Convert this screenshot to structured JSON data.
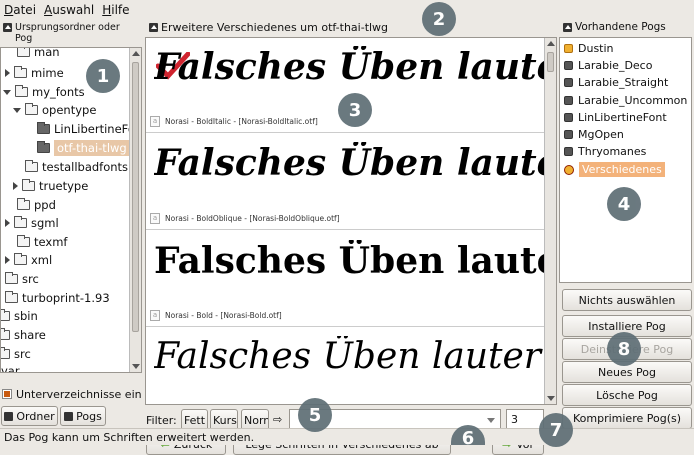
{
  "menu": [
    "Datei",
    "Auswahl",
    "Hilfe"
  ],
  "left_panel": {
    "title": "Ursprungsordner oder Pog",
    "tree": [
      {
        "label": "man"
      },
      {
        "label": "mime"
      },
      {
        "label": "my_fonts"
      },
      {
        "label": "opentype"
      },
      {
        "label": "LinLibertineFo"
      },
      {
        "label": "otf-thai-tlwg"
      },
      {
        "label": "testallbadfonts"
      },
      {
        "label": "truetype"
      },
      {
        "label": "ppd"
      },
      {
        "label": "sgml"
      },
      {
        "label": "texmf"
      },
      {
        "label": "xml"
      },
      {
        "label": "src"
      },
      {
        "label": "turboprint-1.93"
      },
      {
        "label": "sbin"
      },
      {
        "label": "share"
      },
      {
        "label": "src"
      },
      {
        "label": "var"
      }
    ],
    "recurse_checkbox": "Unterverzeichnisse ein",
    "recurse_checked": true,
    "tab_ordner": "Ordner",
    "tab_pogs": "Pogs"
  },
  "center_panel": {
    "title": "Erweitere Verschiedenes um otf-thai-tlwg",
    "sample_text": "Falsches Üben lauter X",
    "fonts": [
      {
        "caption": "Norasi - BoldItalic - [Norasi-BoldItalic.otf]"
      },
      {
        "caption": "Norasi - BoldOblique - [Norasi-BoldOblique.otf]"
      },
      {
        "caption": "Norasi - Bold - [Norasi-Bold.otf]"
      },
      {
        "caption": ""
      }
    ],
    "filter_label": "Filter:",
    "filter_buttons": [
      "Fett",
      "Kursiv",
      "Normal"
    ],
    "filter_value": "",
    "size_value": "3",
    "back_button": "Zurück",
    "install_into_button": "Lege Schriften in Verschiedenes ab",
    "forward_button": "Vor"
  },
  "right_panel": {
    "title": "Vorhandene Pogs",
    "pogs": [
      {
        "label": "Dustin",
        "icon": "orange"
      },
      {
        "label": "Larabie_Deco",
        "icon": "dark"
      },
      {
        "label": "Larabie_Straight",
        "icon": "dark"
      },
      {
        "label": "Larabie_Uncommon",
        "icon": "dark"
      },
      {
        "label": "LinLibertineFont",
        "icon": "dark"
      },
      {
        "label": "MgOpen",
        "icon": "dark"
      },
      {
        "label": "Thryomanes",
        "icon": "dark"
      },
      {
        "label": "Verschiedenes",
        "icon": "current"
      }
    ],
    "buttons": {
      "select_none": "Nichts auswählen",
      "install": "Installiere Pog",
      "uninstall": "Deinstalliere Pog",
      "new": "Neues Pog",
      "delete": "Lösche Pog",
      "compress": "Komprimiere Pog(s)"
    }
  },
  "status_text": "Das Pog kann um Schriften erweitert werden.",
  "badges": [
    "1",
    "2",
    "3",
    "4",
    "5",
    "6",
    "7",
    "8"
  ],
  "colors": {
    "badge": "#5e6e75",
    "selection": "#e8c7a7",
    "check": "#d0242f"
  }
}
